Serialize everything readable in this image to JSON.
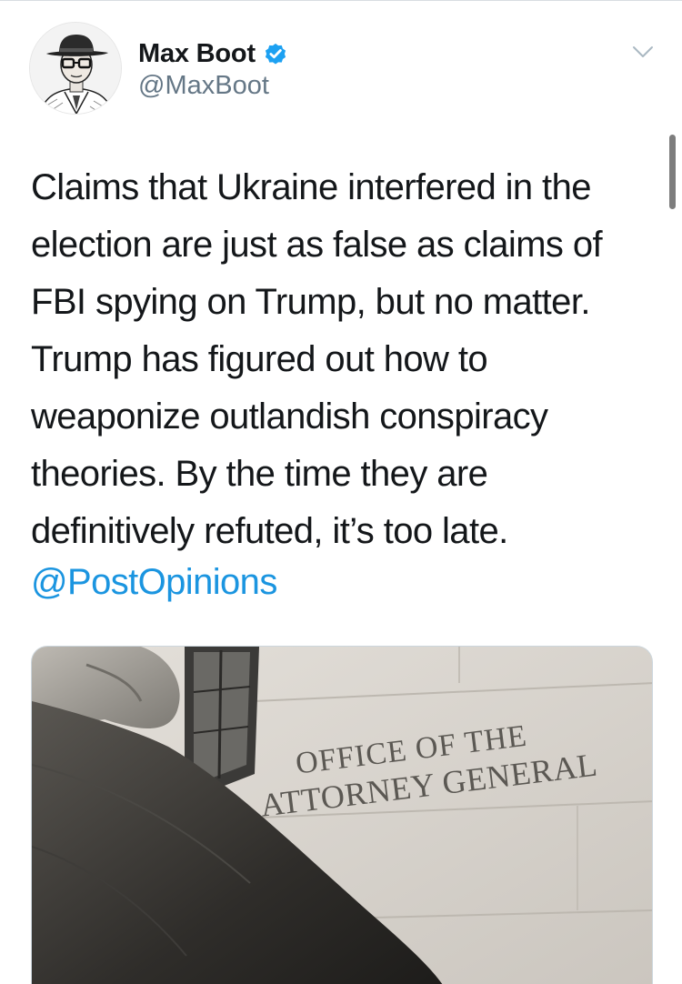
{
  "author": {
    "display_name": "Max Boot",
    "handle": "@MaxBoot",
    "verified": true,
    "avatar_icon": "avatar-portrait-illustration"
  },
  "tweet": {
    "text": "Claims that Ukraine interfered in the\nelection are just as false as claims of\nFBI spying on Trump, but no matter.\nTrump has figured out how to\nweaponize outlandish conspiracy\ntheories. By the time they are\ndefinitively refuted, it’s too late.",
    "mention": "@PostOpinions"
  },
  "card": {
    "image_sign_line1": "OFFICE OF THE",
    "image_sign_line2": "ATTORNEY GENERAL"
  },
  "colors": {
    "link": "#1b95e0",
    "verified_badge": "#1da1f2",
    "secondary_text": "#657786"
  },
  "icons": {
    "verified": "verified-badge-icon",
    "menu": "chevron-down-icon"
  }
}
